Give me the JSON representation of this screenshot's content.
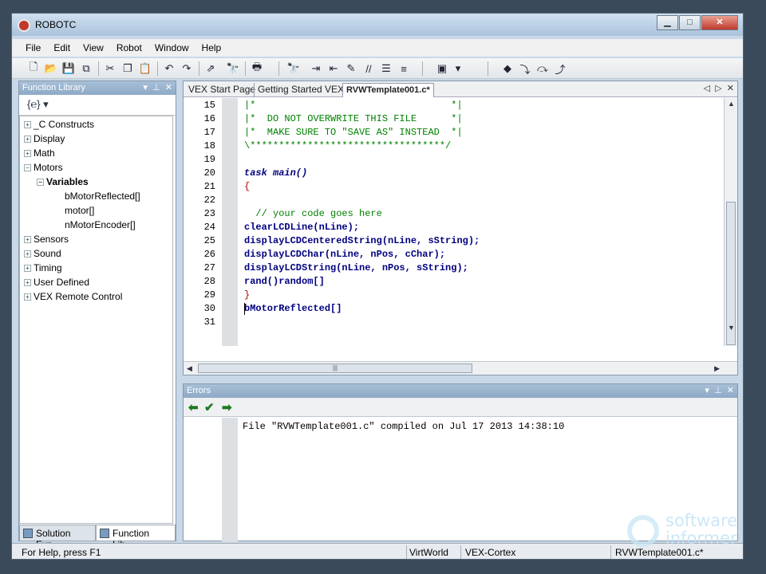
{
  "window": {
    "title": "ROBOTC"
  },
  "menu": [
    "File",
    "Edit",
    "View",
    "Robot",
    "Window",
    "Help"
  ],
  "function_library": {
    "title": "Function Library",
    "tree": [
      {
        "label": "_C Constructs",
        "expander": "+"
      },
      {
        "label": "Display",
        "expander": "+"
      },
      {
        "label": "Math",
        "expander": "+"
      },
      {
        "label": "Motors",
        "expander": "−"
      },
      {
        "label": "Variables",
        "expander": "−"
      },
      {
        "label": "bMotorReflected[]"
      },
      {
        "label": "motor[]"
      },
      {
        "label": "nMotorEncoder[]"
      },
      {
        "label": "Sensors",
        "expander": "+"
      },
      {
        "label": "Sound",
        "expander": "+"
      },
      {
        "label": "Timing",
        "expander": "+"
      },
      {
        "label": "User Defined",
        "expander": "+"
      },
      {
        "label": "VEX Remote Control",
        "expander": "+"
      }
    ],
    "bottom_tabs": [
      "Solution Exp...",
      "Function Lib..."
    ]
  },
  "editor": {
    "tabs": [
      "VEX Start Page",
      "Getting Started VEX",
      "RVWTemplate001.c*"
    ],
    "line_numbers": [
      "15",
      "16",
      "17",
      "18",
      "19",
      "20",
      "21",
      "22",
      "23",
      "24",
      "25",
      "26",
      "27",
      "28",
      "29",
      "30",
      "31"
    ],
    "lines": [
      "|*                                  *|",
      "|*  DO NOT OVERWRITE THIS FILE      *|",
      "|*  MAKE SURE TO \"SAVE AS\" INSTEAD  *|",
      "\\**********************************/",
      "",
      "task main()",
      "{",
      "",
      "  // your code goes here",
      "clearLCDLine(nLine);",
      "displayLCDCenteredString(nLine, sString);",
      "displayLCDChar(nLine, nPos, cChar);",
      "displayLCDString(nLine, nPos, sString);",
      "rand()random[]",
      "}",
      "bMotorReflected[]",
      ""
    ]
  },
  "errors": {
    "title": "Errors",
    "message": "File \"RVWTemplate001.c\" compiled on Jul 17 2013 14:38:10"
  },
  "status": {
    "help": "For Help, press F1",
    "world": "VirtWorld",
    "platform": "VEX-Cortex",
    "file": "RVWTemplate001.c*"
  },
  "watermark": [
    "software",
    "informer"
  ]
}
